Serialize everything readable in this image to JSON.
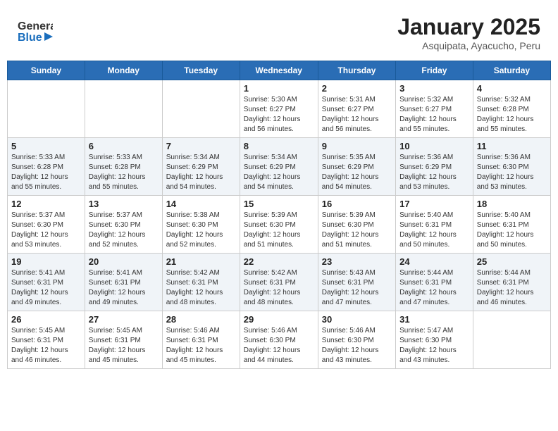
{
  "header": {
    "logo_line1": "General",
    "logo_line2": "Blue",
    "month": "January 2025",
    "location": "Asquipata, Ayacucho, Peru"
  },
  "days_of_week": [
    "Sunday",
    "Monday",
    "Tuesday",
    "Wednesday",
    "Thursday",
    "Friday",
    "Saturday"
  ],
  "weeks": [
    [
      {
        "day": "",
        "info": ""
      },
      {
        "day": "",
        "info": ""
      },
      {
        "day": "",
        "info": ""
      },
      {
        "day": "1",
        "info": "Sunrise: 5:30 AM\nSunset: 6:27 PM\nDaylight: 12 hours\nand 56 minutes."
      },
      {
        "day": "2",
        "info": "Sunrise: 5:31 AM\nSunset: 6:27 PM\nDaylight: 12 hours\nand 56 minutes."
      },
      {
        "day": "3",
        "info": "Sunrise: 5:32 AM\nSunset: 6:27 PM\nDaylight: 12 hours\nand 55 minutes."
      },
      {
        "day": "4",
        "info": "Sunrise: 5:32 AM\nSunset: 6:28 PM\nDaylight: 12 hours\nand 55 minutes."
      }
    ],
    [
      {
        "day": "5",
        "info": "Sunrise: 5:33 AM\nSunset: 6:28 PM\nDaylight: 12 hours\nand 55 minutes."
      },
      {
        "day": "6",
        "info": "Sunrise: 5:33 AM\nSunset: 6:28 PM\nDaylight: 12 hours\nand 55 minutes."
      },
      {
        "day": "7",
        "info": "Sunrise: 5:34 AM\nSunset: 6:29 PM\nDaylight: 12 hours\nand 54 minutes."
      },
      {
        "day": "8",
        "info": "Sunrise: 5:34 AM\nSunset: 6:29 PM\nDaylight: 12 hours\nand 54 minutes."
      },
      {
        "day": "9",
        "info": "Sunrise: 5:35 AM\nSunset: 6:29 PM\nDaylight: 12 hours\nand 54 minutes."
      },
      {
        "day": "10",
        "info": "Sunrise: 5:36 AM\nSunset: 6:29 PM\nDaylight: 12 hours\nand 53 minutes."
      },
      {
        "day": "11",
        "info": "Sunrise: 5:36 AM\nSunset: 6:30 PM\nDaylight: 12 hours\nand 53 minutes."
      }
    ],
    [
      {
        "day": "12",
        "info": "Sunrise: 5:37 AM\nSunset: 6:30 PM\nDaylight: 12 hours\nand 53 minutes."
      },
      {
        "day": "13",
        "info": "Sunrise: 5:37 AM\nSunset: 6:30 PM\nDaylight: 12 hours\nand 52 minutes."
      },
      {
        "day": "14",
        "info": "Sunrise: 5:38 AM\nSunset: 6:30 PM\nDaylight: 12 hours\nand 52 minutes."
      },
      {
        "day": "15",
        "info": "Sunrise: 5:39 AM\nSunset: 6:30 PM\nDaylight: 12 hours\nand 51 minutes."
      },
      {
        "day": "16",
        "info": "Sunrise: 5:39 AM\nSunset: 6:30 PM\nDaylight: 12 hours\nand 51 minutes."
      },
      {
        "day": "17",
        "info": "Sunrise: 5:40 AM\nSunset: 6:31 PM\nDaylight: 12 hours\nand 50 minutes."
      },
      {
        "day": "18",
        "info": "Sunrise: 5:40 AM\nSunset: 6:31 PM\nDaylight: 12 hours\nand 50 minutes."
      }
    ],
    [
      {
        "day": "19",
        "info": "Sunrise: 5:41 AM\nSunset: 6:31 PM\nDaylight: 12 hours\nand 49 minutes."
      },
      {
        "day": "20",
        "info": "Sunrise: 5:41 AM\nSunset: 6:31 PM\nDaylight: 12 hours\nand 49 minutes."
      },
      {
        "day": "21",
        "info": "Sunrise: 5:42 AM\nSunset: 6:31 PM\nDaylight: 12 hours\nand 48 minutes."
      },
      {
        "day": "22",
        "info": "Sunrise: 5:42 AM\nSunset: 6:31 PM\nDaylight: 12 hours\nand 48 minutes."
      },
      {
        "day": "23",
        "info": "Sunrise: 5:43 AM\nSunset: 6:31 PM\nDaylight: 12 hours\nand 47 minutes."
      },
      {
        "day": "24",
        "info": "Sunrise: 5:44 AM\nSunset: 6:31 PM\nDaylight: 12 hours\nand 47 minutes."
      },
      {
        "day": "25",
        "info": "Sunrise: 5:44 AM\nSunset: 6:31 PM\nDaylight: 12 hours\nand 46 minutes."
      }
    ],
    [
      {
        "day": "26",
        "info": "Sunrise: 5:45 AM\nSunset: 6:31 PM\nDaylight: 12 hours\nand 46 minutes."
      },
      {
        "day": "27",
        "info": "Sunrise: 5:45 AM\nSunset: 6:31 PM\nDaylight: 12 hours\nand 45 minutes."
      },
      {
        "day": "28",
        "info": "Sunrise: 5:46 AM\nSunset: 6:31 PM\nDaylight: 12 hours\nand 45 minutes."
      },
      {
        "day": "29",
        "info": "Sunrise: 5:46 AM\nSunset: 6:30 PM\nDaylight: 12 hours\nand 44 minutes."
      },
      {
        "day": "30",
        "info": "Sunrise: 5:46 AM\nSunset: 6:30 PM\nDaylight: 12 hours\nand 43 minutes."
      },
      {
        "day": "31",
        "info": "Sunrise: 5:47 AM\nSunset: 6:30 PM\nDaylight: 12 hours\nand 43 minutes."
      },
      {
        "day": "",
        "info": ""
      }
    ]
  ]
}
